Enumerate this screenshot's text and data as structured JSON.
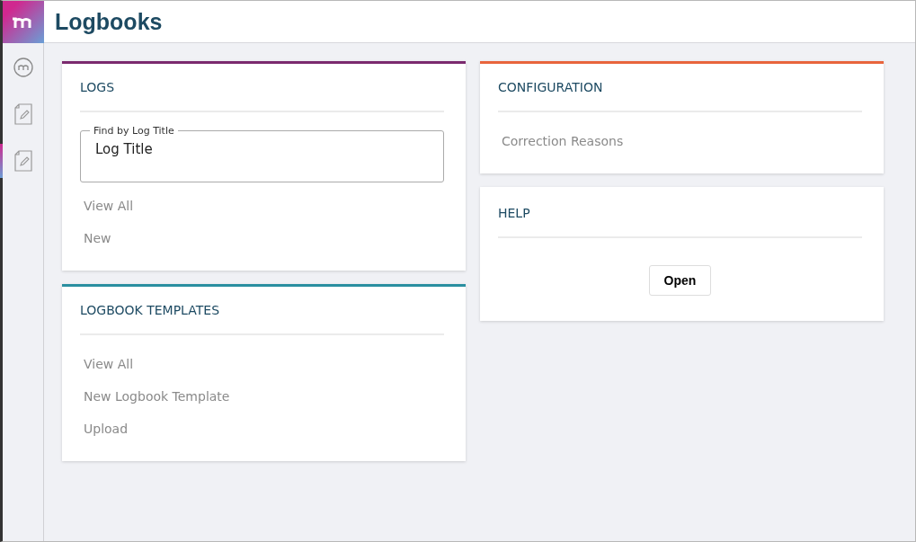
{
  "header": {
    "title": "Logbooks"
  },
  "sidebar": {
    "items": [
      {
        "kind": "brand",
        "selected": false
      },
      {
        "kind": "document",
        "selected": false
      },
      {
        "kind": "document",
        "selected": true
      }
    ]
  },
  "columns": [
    {
      "cards": [
        {
          "title": "LOGS",
          "color": "#7b2a6e",
          "items": [
            {
              "kind": "field",
              "label": "Find by Log Title",
              "value": "Log Title"
            },
            {
              "kind": "link",
              "text": "View All"
            },
            {
              "kind": "link",
              "text": "New"
            }
          ]
        },
        {
          "title": "LOGBOOK TEMPLATES",
          "color": "#2a8fa0",
          "items": [
            {
              "kind": "link",
              "text": "View All"
            },
            {
              "kind": "link",
              "text": "New Logbook Template"
            },
            {
              "kind": "link",
              "text": "Upload"
            }
          ]
        }
      ]
    },
    {
      "cards": [
        {
          "title": "CONFIGURATION",
          "color": "#e8643c",
          "items": [
            {
              "kind": "link",
              "text": "Correction Reasons"
            }
          ]
        },
        {
          "title": "HELP",
          "items": [
            {
              "kind": "button",
              "text": "Open"
            }
          ]
        }
      ]
    }
  ]
}
